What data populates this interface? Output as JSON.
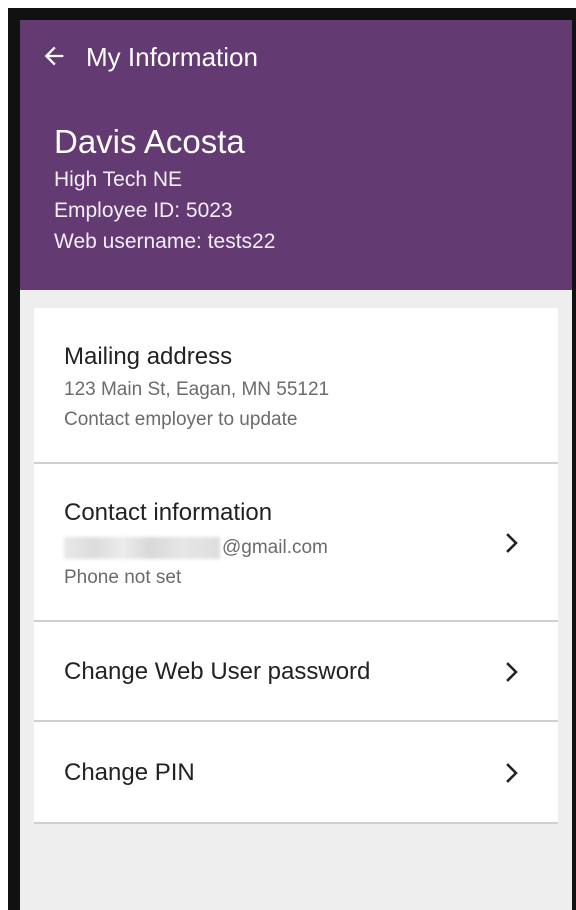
{
  "app_bar": {
    "title": "My Information",
    "back_icon": "arrow-left-icon"
  },
  "profile": {
    "name": "Davis Acosta",
    "company": "High Tech NE",
    "employee_id": "Employee ID: 5023",
    "web_username": "Web username: tests22"
  },
  "sections": {
    "mailing": {
      "title": "Mailing address",
      "address": "123 Main St, Eagan, MN 55121",
      "note": "Contact employer to update"
    },
    "contact": {
      "title": "Contact information",
      "email_domain": "@gmail.com",
      "phone": "Phone not set",
      "chevron_icon": "chevron-right-icon"
    },
    "password": {
      "title": "Change Web User password",
      "chevron_icon": "chevron-right-icon"
    },
    "pin": {
      "title": "Change PIN",
      "chevron_icon": "chevron-right-icon"
    }
  },
  "colors": {
    "header_bg": "#643a73",
    "screen_bg": "#eeeeee",
    "card_bg": "#ffffff",
    "primary_text": "#222222",
    "secondary_text": "#6b6b6b"
  }
}
